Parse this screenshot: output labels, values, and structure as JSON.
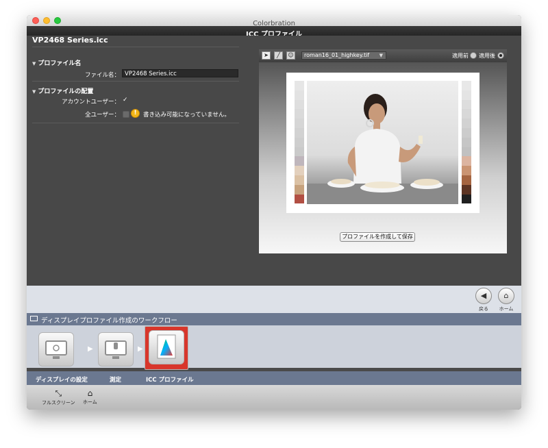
{
  "window": {
    "title": "Colorbration",
    "header": "ICC プロファイル"
  },
  "profile": {
    "heading": "VP2468 Series.icc",
    "section_name": "プロファイル名",
    "filename_label": "ファイル名：",
    "filename_value": "VP2468 Series.icc",
    "section_placement": "プロファイルの配置",
    "account_user_label": "アカウントユーザー：",
    "account_user_checked": "✓",
    "all_users_label": "全ユーザー：",
    "all_users_warning": "書き込み可能になっていません。"
  },
  "preview": {
    "image_select": "roman16_01_highkey.tif",
    "before_label": "適用前",
    "after_label": "適用後",
    "save_button": "プロファイルを作成して保存",
    "swatch_left": [
      "#e6e6e6",
      "#e2e2e2",
      "#dedede",
      "#dadada",
      "#d6d6d6",
      "#d2d2d2",
      "#cecece",
      "#cacaca",
      "#bfb6bc",
      "#e3d0bd",
      "#dbc1a4",
      "#c7a27d",
      "#b24f43"
    ],
    "swatch_right": [
      "#e8e8e8",
      "#e4e4e4",
      "#dddddd",
      "#d8d8d8",
      "#d2d2d2",
      "#cccccc",
      "#c6c6c6",
      "#c1c1c1",
      "#dcb4a0",
      "#ca9472",
      "#a56541",
      "#5d3524",
      "#202020"
    ]
  },
  "nav": {
    "back_label": "戻る",
    "home_label": "ホーム"
  },
  "workflow": {
    "title": "ディスプレイプロファイル作成のワークフロー",
    "steps": [
      {
        "label": "ディスプレイの設定"
      },
      {
        "label": "測定"
      },
      {
        "label": "ICC プロファイル"
      }
    ]
  },
  "bottombar": {
    "fullscreen_label": "フルスクリーン",
    "home_label": "ホーム"
  },
  "colors": {
    "accent_active_step": "#d8362b",
    "workflow_bar": "#6b7890",
    "warning": "#f3b619"
  }
}
